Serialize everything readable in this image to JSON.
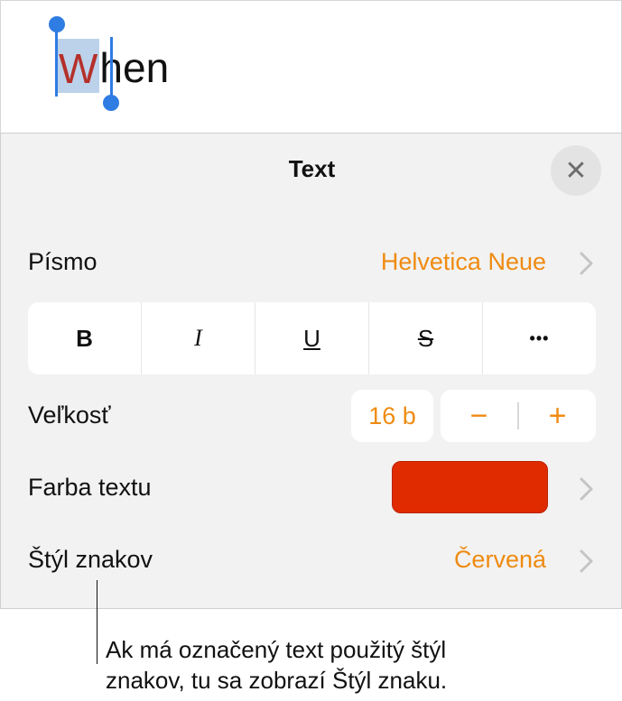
{
  "document": {
    "selected_letter": "W",
    "rest_of_word": "hen"
  },
  "panel": {
    "title": "Text",
    "close_icon": "close-icon",
    "font_row": {
      "label": "Písmo",
      "value": "Helvetica Neue"
    },
    "style_buttons": [
      {
        "label": "B",
        "name": "bold"
      },
      {
        "label": "I",
        "name": "italic"
      },
      {
        "label": "U",
        "name": "underline"
      },
      {
        "label": "S",
        "name": "strikethrough"
      },
      {
        "label": "•••",
        "name": "more"
      }
    ],
    "size_row": {
      "label": "Veľkosť",
      "value": "16 b",
      "minus": "−",
      "plus": "+"
    },
    "color_row": {
      "label": "Farba textu",
      "swatch_color": "#e02a00"
    },
    "char_style_row": {
      "label": "Štýl znakov",
      "value": "Červená"
    }
  },
  "callout": {
    "line1": "Ak má označený text použitý štýl",
    "line2": "znakov, tu sa zobrazí Štýl znaku."
  },
  "colors": {
    "accent": "#ef8b12",
    "selection_handle": "#2f7ce3",
    "selection_highlight": "#bcd2ea",
    "selected_text": "#b4302a"
  }
}
